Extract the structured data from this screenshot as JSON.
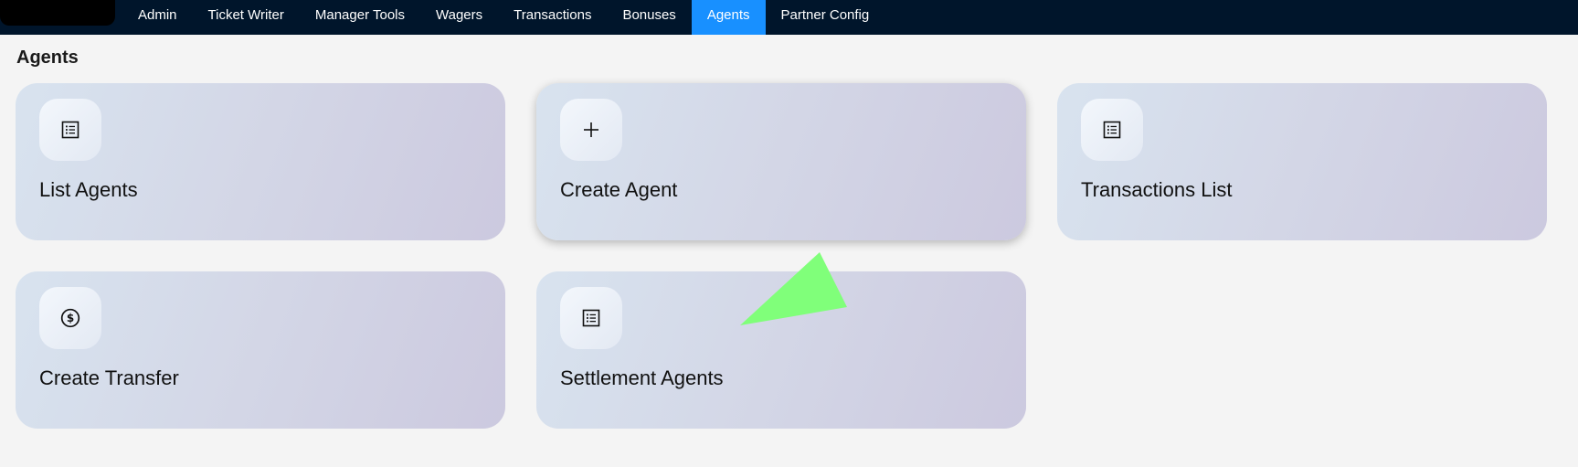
{
  "nav": {
    "items": [
      {
        "label": "Admin",
        "active": false
      },
      {
        "label": "Ticket Writer",
        "active": false
      },
      {
        "label": "Manager Tools",
        "active": false
      },
      {
        "label": "Wagers",
        "active": false
      },
      {
        "label": "Transactions",
        "active": false
      },
      {
        "label": "Bonuses",
        "active": false
      },
      {
        "label": "Agents",
        "active": true
      },
      {
        "label": "Partner Config",
        "active": false
      }
    ],
    "active_color": "#1890ff",
    "bar_color": "#00152b"
  },
  "page": {
    "title": "Agents"
  },
  "cards": [
    {
      "label": "List Agents",
      "icon": "list-icon"
    },
    {
      "label": "Create Agent",
      "icon": "plus-icon"
    },
    {
      "label": "Transactions List",
      "icon": "list-icon"
    },
    {
      "label": "Create Transfer",
      "icon": "dollar-circle-icon"
    },
    {
      "label": "Settlement Agents",
      "icon": "list-icon"
    }
  ]
}
